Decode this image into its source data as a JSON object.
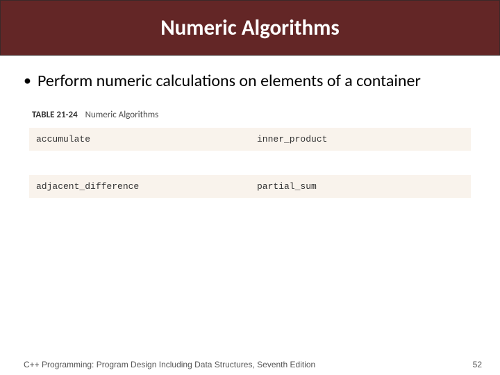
{
  "header": {
    "title": "Numeric Algorithms"
  },
  "bullet": "Perform numeric calculations on elements of a container",
  "table": {
    "label_num": "TABLE 21-24",
    "label_text": "Numeric Algorithms",
    "rows": [
      {
        "c1": "accumulate",
        "c2": "inner_product"
      },
      {
        "c1": "",
        "c2": ""
      },
      {
        "c1": "adjacent_difference",
        "c2": "partial_sum"
      }
    ]
  },
  "footer": {
    "book": "C++ Programming: Program Design Including Data Structures, Seventh Edition",
    "page": "52"
  }
}
